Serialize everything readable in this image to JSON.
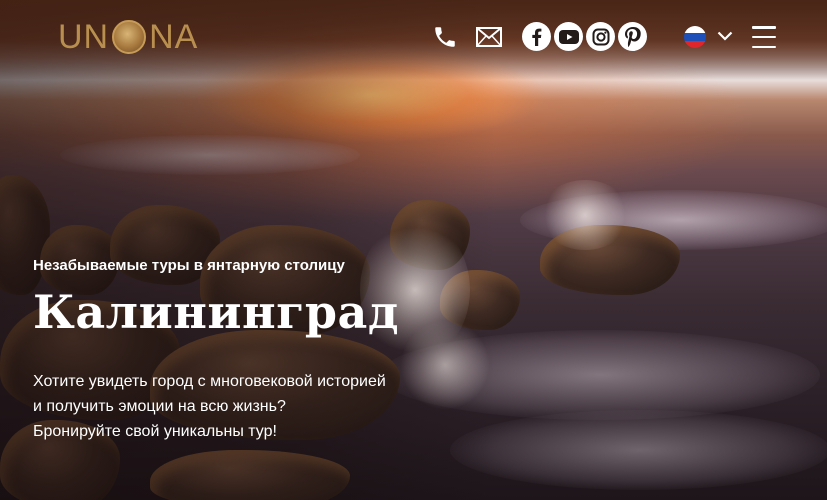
{
  "header": {
    "logo": {
      "text_left": "UN",
      "text_right": "NA"
    },
    "icons": {
      "phone": "phone-icon",
      "mail": "mail-icon",
      "facebook": "facebook-icon",
      "youtube": "youtube-icon",
      "instagram": "instagram-icon",
      "pinterest": "pinterest-icon",
      "language_flag": "russia-flag-icon",
      "chevron": "chevron-down-icon",
      "menu": "hamburger-menu-icon"
    }
  },
  "hero": {
    "subtitle": "Незабываемые туры в янтарную столицу",
    "title": "Калининград",
    "description_lines": [
      "Хотите увидеть город с многовековой историей",
      "и получить эмоции на всю жизнь?",
      "Бронируйте свой уникальны тур!"
    ]
  },
  "colors": {
    "logo_gold": "#b98f4f",
    "text": "#ffffff",
    "flag_blue": "#1e4fb8",
    "flag_red": "#e0262d"
  }
}
